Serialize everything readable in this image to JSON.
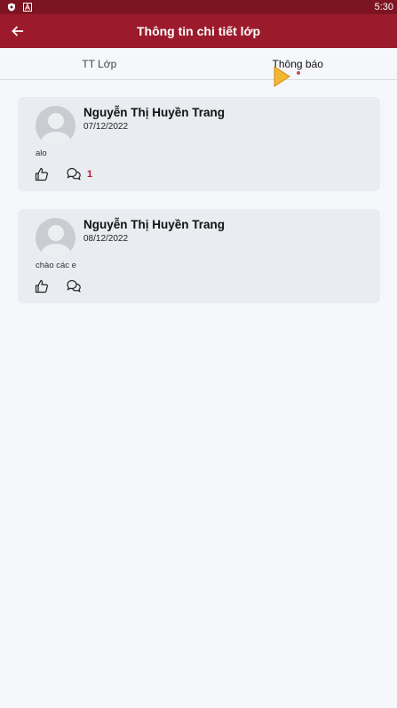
{
  "status_bar": {
    "time": "5:30"
  },
  "app_bar": {
    "title": "Thông tin chi tiết lớp",
    "back_icon": "arrow-back-icon"
  },
  "tabs": [
    {
      "label": "TT Lớp",
      "active": false
    },
    {
      "label": "Thông báo",
      "active": true
    }
  ],
  "posts": [
    {
      "author": "Nguyễn Thị Huyền Trang",
      "date": "07/12/2022",
      "text": "alo",
      "comment_count": "1"
    },
    {
      "author": "Nguyễn Thị Huyền Trang",
      "date": "08/12/2022",
      "text": "chào các e",
      "comment_count": ""
    }
  ],
  "colors": {
    "status_bar": "#7d1422",
    "app_bar": "#9b1b2c",
    "accent": "#b01c2e",
    "card": "#e9ecf0",
    "background": "#f6f7fb"
  }
}
